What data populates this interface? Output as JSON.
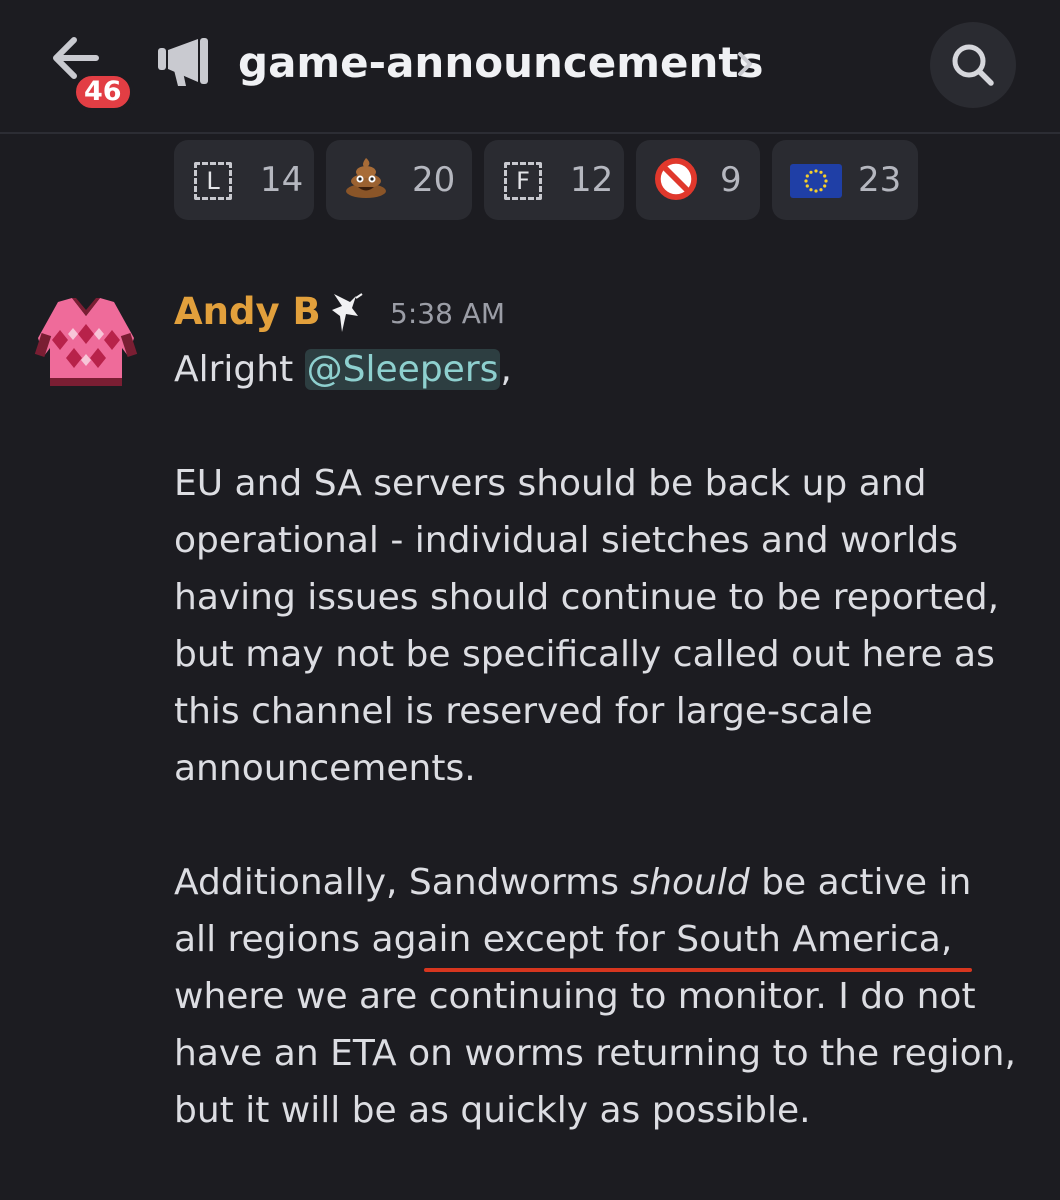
{
  "header": {
    "unread_count": "46",
    "channel_name": "game-announcements",
    "chevron": "›"
  },
  "reactions": [
    {
      "emoji": "L",
      "emoji_kind": "letter-box",
      "count": "14"
    },
    {
      "emoji": "pile-of-poo",
      "emoji_kind": "glyph",
      "glyph": "💩",
      "count": "20"
    },
    {
      "emoji": "F",
      "emoji_kind": "letter-box",
      "count": "12"
    },
    {
      "emoji": "no-entry-sign",
      "emoji_kind": "glyph",
      "glyph": "🚫",
      "count": "9"
    },
    {
      "emoji": "eu-flag",
      "emoji_kind": "glyph",
      "glyph": "🇪🇺",
      "count": "23"
    }
  ],
  "message": {
    "author": "Andy B",
    "author_color": "#e2a03c",
    "timestamp": "5:38 AM",
    "greeting": "Alright ",
    "mention": "@Sleepers",
    "greeting_end": ",",
    "paragraph1": [
      "EU and SA servers should be back up and",
      "operational - individual sietches and worlds",
      "having issues should continue to be reported,",
      "but may not be specifically called out here as",
      "this channel is reserved for large-scale",
      "announcements."
    ],
    "p2_line1_pre": "Additionally, Sandworms ",
    "p2_line1_em": "should",
    "p2_line1_post": " be active in",
    "paragraph2": [
      "all regions again except for South America,",
      "where we are continuing to monitor. I do not",
      "have an ETA on worms returning to the region,",
      "but it will be as quickly as possible."
    ]
  },
  "colors": {
    "background": "#1c1c21",
    "badge": "#e23e44",
    "mention_text": "#8ed0cf",
    "underline_annotation": "#d7361f"
  },
  "icons": [
    "back-arrow-icon",
    "megaphone-icon",
    "chevron-right-icon",
    "search-icon",
    "sweater-avatar",
    "role-icon"
  ]
}
